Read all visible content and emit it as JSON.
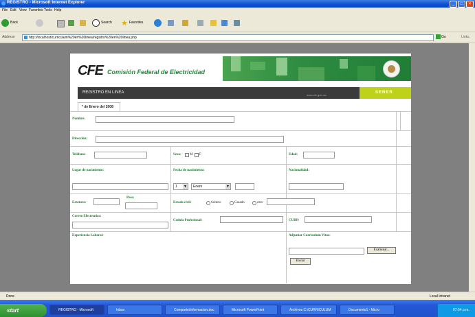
{
  "window": {
    "title": "REGISTRO - Microsoft Internet Explorer",
    "controls": [
      "_",
      "□",
      "×"
    ]
  },
  "menu": [
    "File",
    "Edit",
    "View",
    "Favorites",
    "Tools",
    "Help"
  ],
  "toolbar": {
    "back_label": "Back",
    "search_label": "Search",
    "favorites_label": "Favorites"
  },
  "address": {
    "label": "Address",
    "url": "http://localhost/curriculum%20en%20linea/registro%20en%20linea.php",
    "go_label": "Go",
    "links_label": "Links"
  },
  "header": {
    "logo": "CFE",
    "logo_subtitle": "Comisión Federal de Electricidad",
    "register_label": "REGISTRO EN LINEA",
    "url_text": "www.cfe.gob.mx",
    "sener_label": "SENER"
  },
  "tab": {
    "label": "* de Enero del 2008"
  },
  "form": {
    "nombre_label": "Nombre:",
    "direccion_label": "Dirección:",
    "telefono_label": "Teléfono:",
    "sexo_label": "Sexo:",
    "sexo_m": "M",
    "sexo_f": "F",
    "edad_label": "Edad:",
    "lugar_label": "Lugar de nacimiento:",
    "fecha_label": "Fecha de nacimiento:",
    "fecha_dia": "1",
    "fecha_mes": "Enero",
    "nacionalidad_label": "Nacionalidad:",
    "estatura_label": "Estatura:",
    "peso_label": "Peso:",
    "estado_label": "Estado civil:",
    "estado_opts": [
      "Soltero",
      "Casado",
      "otro"
    ],
    "correo_label": "Correo Electronico:",
    "cedula_label": "Cedula Profesional:",
    "curp_label": "CURP:",
    "experiencia_label": "Experiencia Laboral:",
    "adjuntar_label": "Adjuntar Curriculum Vitae:",
    "examinar_label": "Examinar...",
    "enviar_label": "Enviar"
  },
  "status": {
    "text": "Done",
    "zone": "Local intranet"
  },
  "taskbar": {
    "start": "start",
    "tasks": [
      "REGISTRO - Microsoft",
      "Inbox",
      "Comparte/informacion.doc",
      "Microsoft PowerPoint",
      "Archivos C:\\CURRICULUM",
      "Documento1 - Micro"
    ],
    "clock": "07:54 p.m."
  },
  "colors": {
    "cfe_green": "#1c8a38",
    "sener_lime": "#bfd21a",
    "band_green": "#2f8d41"
  }
}
